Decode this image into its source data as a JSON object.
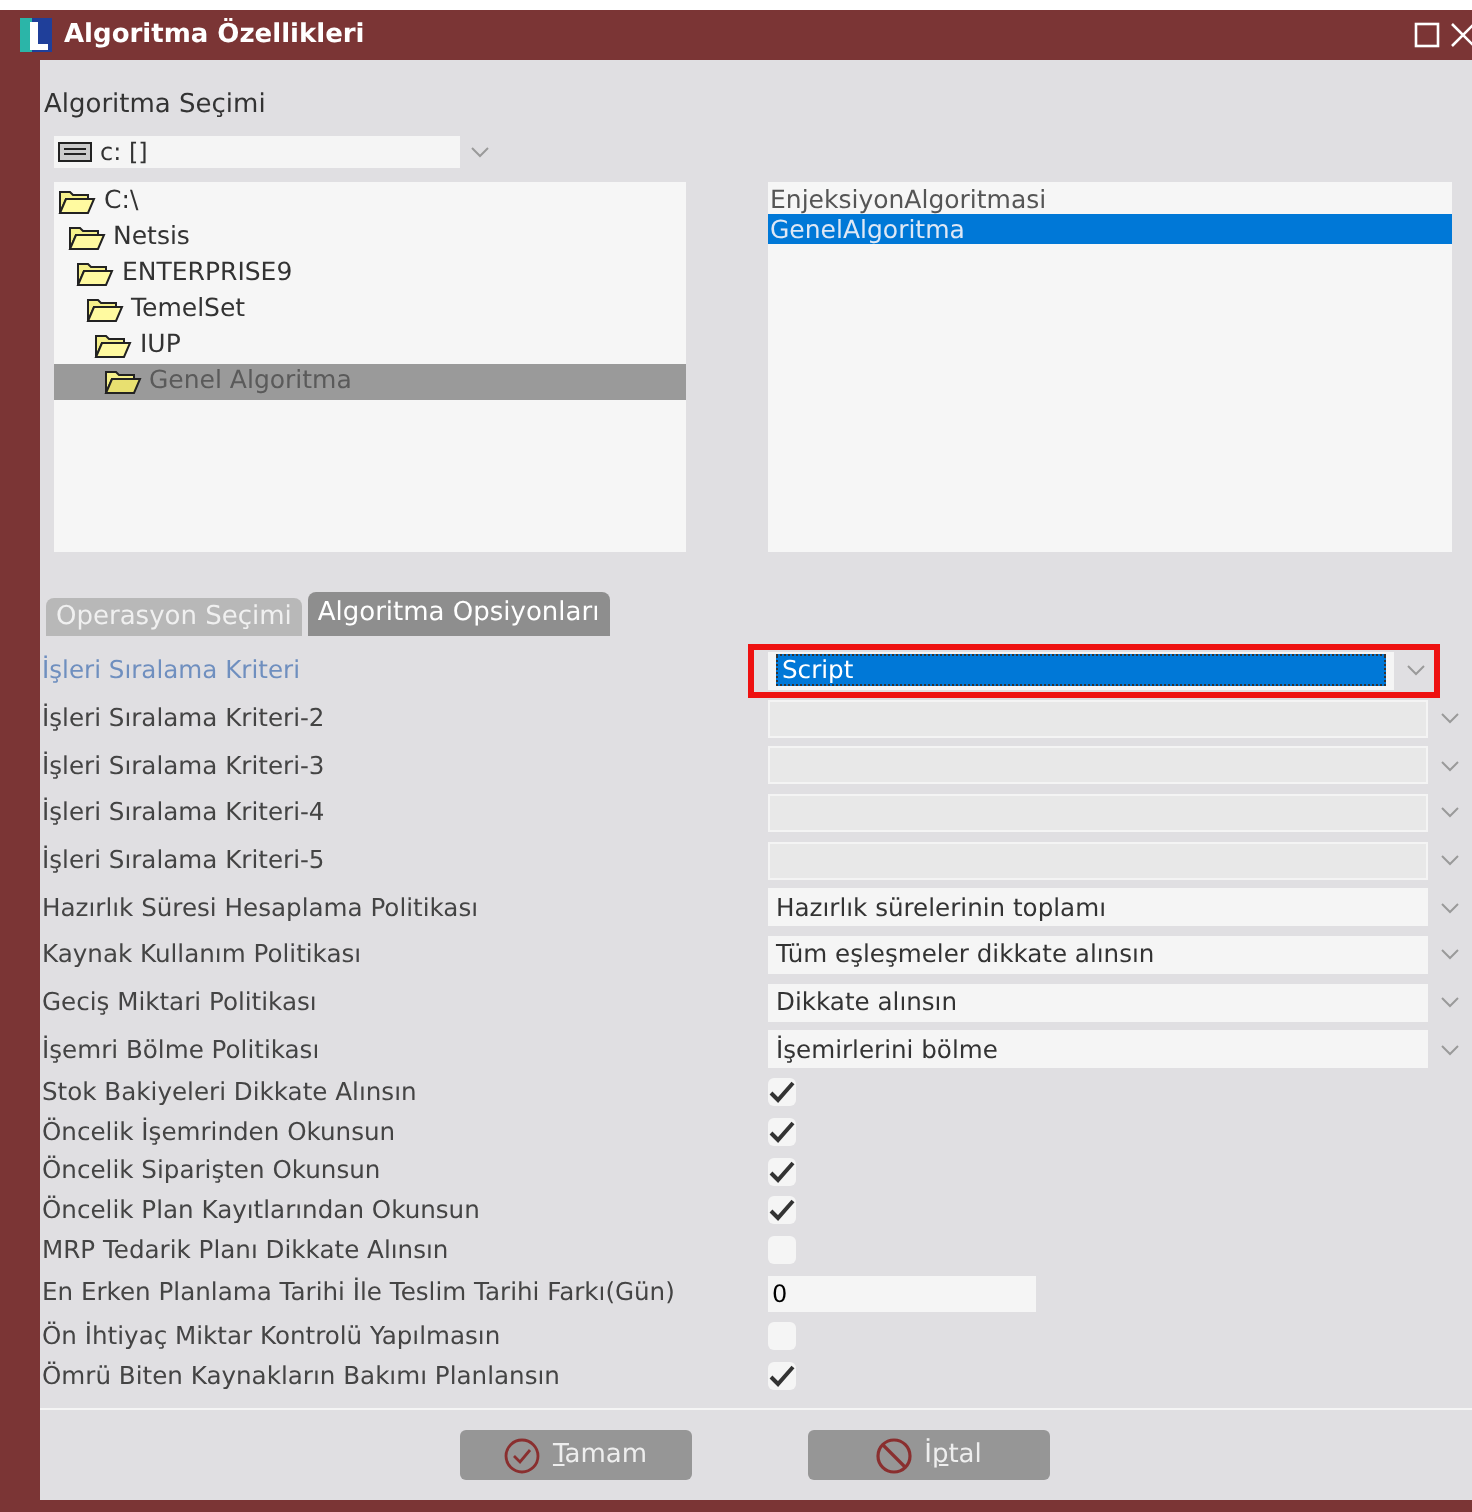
{
  "window": {
    "title": "Algoritma Özellikleri"
  },
  "section_title": "Algoritma Seçimi",
  "drive_select": {
    "value": "c: []"
  },
  "folder_tree": [
    {
      "label": "C:\\",
      "selected": false,
      "children": [
        {
          "label": "Netsis",
          "selected": false,
          "children": [
            {
              "label": "ENTERPRISE9",
              "selected": false,
              "children": [
                {
                  "label": "TemelSet",
                  "selected": false,
                  "children": [
                    {
                      "label": "IUP",
                      "selected": false,
                      "children": [
                        {
                          "label": "Genel Algoritma",
                          "selected": true
                        }
                      ]
                    }
                  ]
                }
              ]
            }
          ]
        }
      ]
    }
  ],
  "file_list": [
    {
      "label": "EnjeksiyonAlgoritmasi",
      "selected": false
    },
    {
      "label": "GenelAlgoritma",
      "selected": true
    }
  ],
  "tabs": [
    {
      "label": "Operasyon Seçimi",
      "selected": false
    },
    {
      "label": "Algoritma Opsiyonları",
      "selected": true
    }
  ],
  "options": [
    {
      "kind": "select",
      "label": "İşleri Sıralama Kriteri",
      "value": "Script",
      "focused": true,
      "disabled": false
    },
    {
      "kind": "select",
      "label": "İşleri Sıralama Kriteri-2",
      "focused": false,
      "disabled": true
    },
    {
      "kind": "select",
      "label": "İşleri Sıralama Kriteri-3",
      "focused": false,
      "disabled": true
    },
    {
      "kind": "select",
      "label": "İşleri Sıralama Kriteri-4",
      "focused": false,
      "disabled": true
    },
    {
      "kind": "select",
      "label": "İşleri Sıralama Kriteri-5",
      "focused": false,
      "disabled": true
    },
    {
      "kind": "select",
      "label": "Hazırlık Süresi Hesaplama Politikası",
      "value": "Hazırlık sürelerinin toplamı",
      "focused": false,
      "disabled": false
    },
    {
      "kind": "select",
      "label": "Kaynak Kullanım Politikası",
      "value": "Tüm eşleşmeler dikkate alınsın",
      "focused": false,
      "disabled": false
    },
    {
      "kind": "select",
      "label": "Geciş Miktari Politikası",
      "value": "Dikkate alınsın",
      "focused": false,
      "disabled": false
    },
    {
      "kind": "select",
      "label": "İşemri Bölme Politikası",
      "value": "İşemirlerini bölme",
      "focused": false,
      "disabled": false
    },
    {
      "kind": "check",
      "label": "Stok Bakiyeleri Dikkate Alınsın",
      "checked": true
    },
    {
      "kind": "check",
      "label": "Öncelik İşemrinden Okunsun",
      "checked": true
    },
    {
      "kind": "check",
      "label": "Öncelik Siparişten Okunsun",
      "checked": true
    },
    {
      "kind": "check",
      "label": "Öncelik Plan Kayıtlarından Okunsun",
      "checked": true
    },
    {
      "kind": "check",
      "label": "MRP Tedarik Planı Dikkate Alınsın",
      "checked": false
    },
    {
      "kind": "text",
      "label": "En Erken Planlama Tarihi İle Teslim Tarihi Farkı(Gün)",
      "value": "0"
    },
    {
      "kind": "check",
      "label": "Ön İhtiyaç Miktar Kontrolü Yapılmasın",
      "checked": false
    },
    {
      "kind": "check",
      "label": "Ömrü Biten Kaynakların Bakımı Planlansın",
      "checked": true
    }
  ],
  "buttons": [
    {
      "kind": "ok",
      "mnemonic": "T",
      "after": "amam"
    },
    {
      "kind": "cancel",
      "before": "İ",
      "mnemonic": "p",
      "after": "tal"
    }
  ]
}
